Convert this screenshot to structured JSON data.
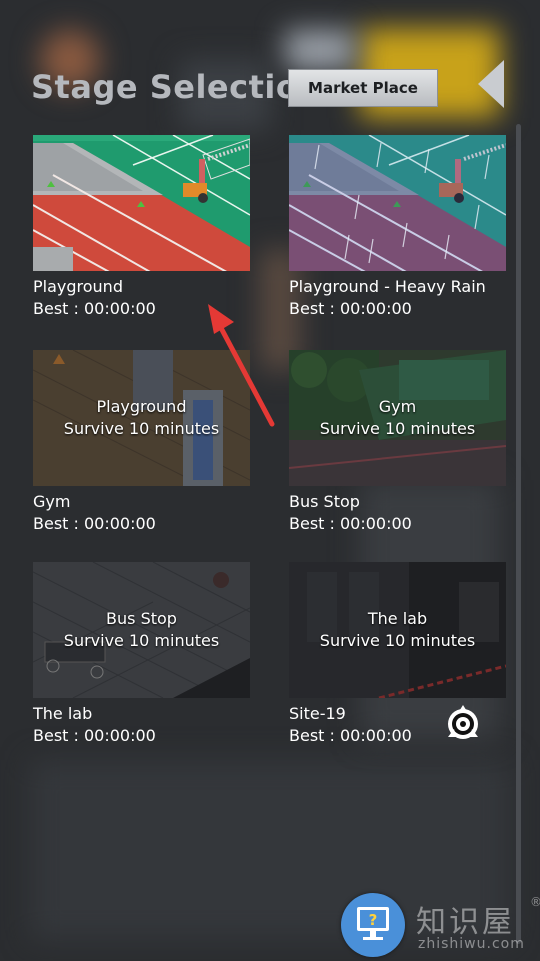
{
  "header": {
    "title": "Stage Selection",
    "market_label": "Market Place"
  },
  "stages": [
    {
      "name": "Playground",
      "best": "Best : 00:00:00",
      "locked": false,
      "overlay_title": "",
      "overlay_sub": ""
    },
    {
      "name": "Playground - Heavy Rain",
      "best": "Best : 00:00:00",
      "locked": false,
      "overlay_title": "",
      "overlay_sub": ""
    },
    {
      "name": "Gym",
      "best": "Best : 00:00:00",
      "locked": true,
      "overlay_title": "Playground",
      "overlay_sub": "Survive 10 minutes"
    },
    {
      "name": "Bus Stop",
      "best": "Best : 00:00:00",
      "locked": true,
      "overlay_title": "Gym",
      "overlay_sub": "Survive 10 minutes"
    },
    {
      "name": "The lab",
      "best": "Best : 00:00:00",
      "locked": true,
      "overlay_title": "Bus Stop",
      "overlay_sub": "Survive 10 minutes"
    },
    {
      "name": "Site-19",
      "best": "Best : 00:00:00",
      "locked": true,
      "overlay_title": "The lab",
      "overlay_sub": "Survive 10 minutes"
    }
  ],
  "watermark": {
    "cn": "知识屋",
    "reg": "®",
    "domain": "zhishiwu.com"
  },
  "colors": {
    "background": "#2b2d30",
    "title": "#b5b8bd",
    "annotation_arrow": "#e53935",
    "help_button": "#4a90d9"
  },
  "icons": [
    "back-arrow-icon",
    "help-icon",
    "site19-logo-icon"
  ]
}
